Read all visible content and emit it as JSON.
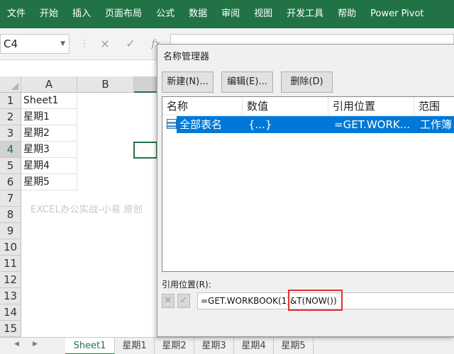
{
  "ribbon": {
    "tabs": [
      "文件",
      "开始",
      "插入",
      "页面布局",
      "公式",
      "数据",
      "审阅",
      "视图",
      "开发工具",
      "帮助",
      "Power Pivot"
    ],
    "bg_color": "#217346"
  },
  "formula_bar": {
    "name_box": "C4",
    "cancel_icon": "×",
    "enter_icon": "✓",
    "fx_icon": "fx"
  },
  "grid": {
    "columns": [
      "A",
      "B"
    ],
    "rows": [
      "1",
      "2",
      "3",
      "4",
      "5",
      "6",
      "7",
      "8",
      "9",
      "10",
      "11",
      "12",
      "13",
      "14",
      "15"
    ],
    "cells": [
      "Sheet1",
      "星期1",
      "星期2",
      "星期3",
      "星期4",
      "星期5"
    ],
    "watermark": "EXCEL办公实战-小易  原创",
    "selected_cell": "C4"
  },
  "sheet_tabs": {
    "tabs": [
      "Sheet1",
      "星期1",
      "星期2",
      "星期3",
      "星期4",
      "星期5"
    ],
    "active": "Sheet1"
  },
  "dialog": {
    "title": "名称管理器",
    "buttons": {
      "new_label": "新建(N)...",
      "edit_label": "编辑(E)...",
      "delete_label": "删除(D)"
    },
    "list_headers": [
      "名称",
      "数值",
      "引用位置",
      "范围"
    ],
    "list_rows": [
      {
        "name": "全部表名",
        "value": "{...}",
        "ref": "=GET.WORK...",
        "scope": "工作簿"
      }
    ],
    "ref_label": "引用位置(R):",
    "ref_value": "=GET.WORKBOOK(1)&T(NOW())",
    "highlight_color": "#e03131",
    "selection_color": "#0078d7"
  }
}
